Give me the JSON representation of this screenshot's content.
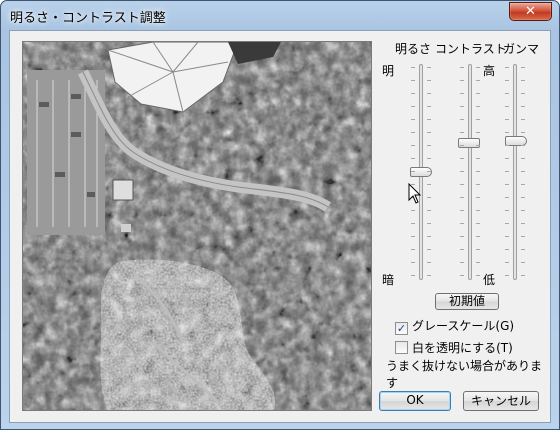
{
  "window": {
    "title": "明るさ・コントラスト調整",
    "close_label": "✕"
  },
  "sliders": {
    "brightness": {
      "label": "明るさ",
      "high_label": "明",
      "low_label": "暗",
      "value": 0.5
    },
    "contrast": {
      "label": "コントラスト",
      "high_label": "高",
      "low_label": "低",
      "value": 0.64
    },
    "gamma": {
      "label": "ガンマ",
      "value": 0.65
    }
  },
  "buttons": {
    "reset_label": "初期値",
    "ok_label": "OK",
    "cancel_label": "キャンセル"
  },
  "options": {
    "grayscale": {
      "label": "グレースケール(G)",
      "checked": true
    },
    "white_transparent": {
      "label": "白を透明にする(T)",
      "checked": false
    },
    "note": "うまく抜けない場合があります"
  },
  "preview": {
    "icon": "aerial-photo-preview"
  }
}
